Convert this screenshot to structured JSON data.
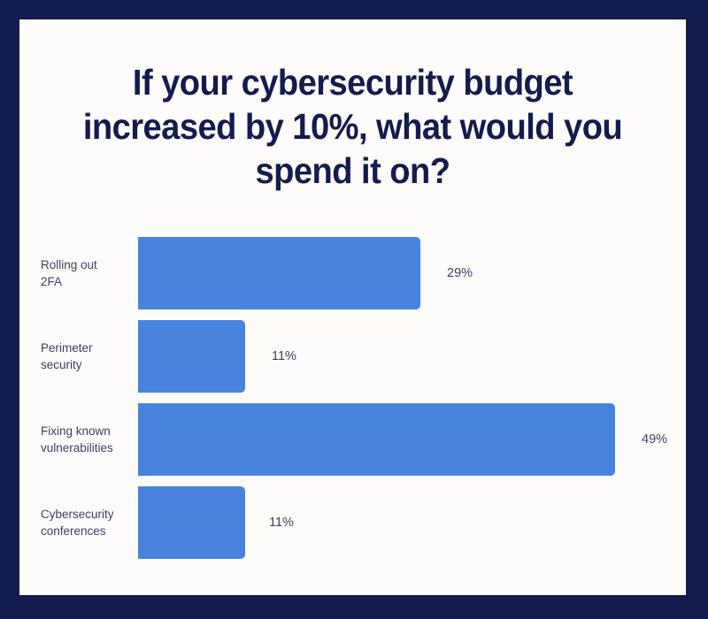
{
  "figure": {
    "frame_color": "#141B4D",
    "card_color": "#FDFCFB"
  },
  "chart_data": {
    "type": "bar",
    "orientation": "horizontal",
    "title": "If your cybersecurity budget\nincreased by 10%, what would you\nspend it on?",
    "title_lines": [
      "If your cybersecurity budget",
      "increased by 10%, what would you",
      "spend it on?"
    ],
    "xlabel": "",
    "ylabel": "",
    "categories": [
      "Rolling out\n2FA",
      "Perimeter\nsecurity",
      "Fixing known\nvulnerabilities",
      "Cybersecurity\nconferences"
    ],
    "values": [
      29,
      11,
      49,
      11
    ],
    "value_labels": [
      "29%",
      "11%",
      "49%",
      "11%"
    ],
    "xlim": [
      0,
      49
    ],
    "grid": false,
    "legend": null,
    "axis_visible": false,
    "bar_color": "#4884DD",
    "title_color": "#141B4D",
    "label_color": "#3C3F63"
  }
}
